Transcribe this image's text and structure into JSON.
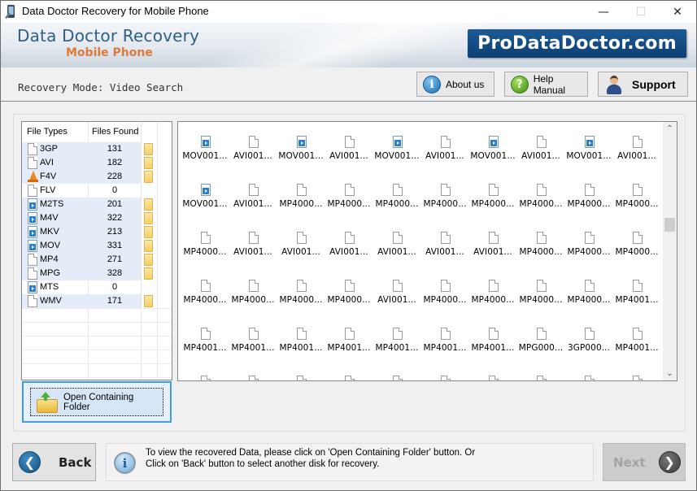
{
  "window": {
    "title": "Data Doctor Recovery for Mobile Phone",
    "controls": {
      "minimize": "—",
      "maximize": "☐",
      "close": "✕"
    }
  },
  "banner": {
    "brand_main": "Data Doctor Recovery",
    "brand_sub": "Mobile Phone",
    "logo_text": "ProDataDoctor.com"
  },
  "toolbar": {
    "mode_label": "Recovery Mode: Video Search",
    "about_label": "About us",
    "help_label": "Help Manual",
    "support_label": "Support",
    "about_icon": "i",
    "help_icon": "?"
  },
  "file_types": {
    "header_type": "File Types",
    "header_found": "Files Found",
    "rows": [
      {
        "type": "3GP",
        "count": "131",
        "icon": "document-icon",
        "has_folder": true
      },
      {
        "type": "AVI",
        "count": "182",
        "icon": "document-icon",
        "has_folder": true
      },
      {
        "type": "F4V",
        "count": "228",
        "icon": "vlc-cone-icon",
        "has_folder": true
      },
      {
        "type": "FLV",
        "count": "0",
        "icon": "document-icon",
        "has_folder": false
      },
      {
        "type": "M2TS",
        "count": "201",
        "icon": "video-file-icon",
        "has_folder": true
      },
      {
        "type": "M4V",
        "count": "322",
        "icon": "video-file-icon",
        "has_folder": true
      },
      {
        "type": "MKV",
        "count": "213",
        "icon": "video-file-icon",
        "has_folder": true
      },
      {
        "type": "MOV",
        "count": "331",
        "icon": "video-file-icon",
        "has_folder": true
      },
      {
        "type": "MP4",
        "count": "271",
        "icon": "document-icon",
        "has_folder": true
      },
      {
        "type": "MPG",
        "count": "328",
        "icon": "document-icon",
        "has_folder": true
      },
      {
        "type": "MTS",
        "count": "0",
        "icon": "video-file-icon",
        "has_folder": false
      },
      {
        "type": "WMV",
        "count": "171",
        "icon": "document-icon",
        "has_folder": true
      }
    ]
  },
  "open_folder": {
    "label": "Open Containing Folder"
  },
  "files": {
    "rows": [
      [
        {
          "name": "MOV001...",
          "icon": "video"
        },
        {
          "name": "AVI001...",
          "icon": "doc"
        },
        {
          "name": "MOV001...",
          "icon": "video"
        },
        {
          "name": "AVI001...",
          "icon": "doc"
        },
        {
          "name": "MOV001...",
          "icon": "video"
        },
        {
          "name": "AVI001...",
          "icon": "doc"
        },
        {
          "name": "MOV001...",
          "icon": "video"
        },
        {
          "name": "AVI001...",
          "icon": "doc"
        },
        {
          "name": "MOV001...",
          "icon": "video"
        },
        {
          "name": "AVI001...",
          "icon": "doc"
        }
      ],
      [
        {
          "name": "MOV001...",
          "icon": "video"
        },
        {
          "name": "AVI001...",
          "icon": "doc"
        },
        {
          "name": "MP4000...",
          "icon": "doc"
        },
        {
          "name": "MP4000...",
          "icon": "doc"
        },
        {
          "name": "MP4000...",
          "icon": "doc"
        },
        {
          "name": "MP4000...",
          "icon": "doc"
        },
        {
          "name": "MP4000...",
          "icon": "doc"
        },
        {
          "name": "MP4000...",
          "icon": "doc"
        },
        {
          "name": "MP4000...",
          "icon": "doc"
        },
        {
          "name": "MP4000...",
          "icon": "doc"
        }
      ],
      [
        {
          "name": "MP4000...",
          "icon": "doc"
        },
        {
          "name": "AVI001...",
          "icon": "doc"
        },
        {
          "name": "AVI001...",
          "icon": "doc"
        },
        {
          "name": "AVI001...",
          "icon": "doc"
        },
        {
          "name": "AVI001...",
          "icon": "doc"
        },
        {
          "name": "AVI001...",
          "icon": "doc"
        },
        {
          "name": "AVI001...",
          "icon": "doc"
        },
        {
          "name": "MP4000...",
          "icon": "doc"
        },
        {
          "name": "MP4000...",
          "icon": "doc"
        },
        {
          "name": "MP4000...",
          "icon": "doc"
        }
      ],
      [
        {
          "name": "MP4000...",
          "icon": "doc"
        },
        {
          "name": "MP4000...",
          "icon": "doc"
        },
        {
          "name": "MP4000...",
          "icon": "doc"
        },
        {
          "name": "MP4000...",
          "icon": "doc"
        },
        {
          "name": "AVI001...",
          "icon": "doc"
        },
        {
          "name": "MP4000...",
          "icon": "doc"
        },
        {
          "name": "MP4000...",
          "icon": "doc"
        },
        {
          "name": "MP4000...",
          "icon": "doc"
        },
        {
          "name": "MP4000...",
          "icon": "doc"
        },
        {
          "name": "MP4001...",
          "icon": "doc"
        }
      ],
      [
        {
          "name": "MP4001...",
          "icon": "doc"
        },
        {
          "name": "MP4001...",
          "icon": "doc"
        },
        {
          "name": "MP4001...",
          "icon": "doc"
        },
        {
          "name": "MP4001...",
          "icon": "doc"
        },
        {
          "name": "MP4001...",
          "icon": "doc"
        },
        {
          "name": "MP4001...",
          "icon": "doc"
        },
        {
          "name": "MP4001...",
          "icon": "doc"
        },
        {
          "name": "MPG000...",
          "icon": "doc"
        },
        {
          "name": "3GP000...",
          "icon": "doc"
        },
        {
          "name": "MP4001...",
          "icon": "doc"
        }
      ],
      [
        {
          "name": "",
          "icon": "doc"
        },
        {
          "name": "",
          "icon": "doc"
        },
        {
          "name": "",
          "icon": "doc"
        },
        {
          "name": "",
          "icon": "doc"
        },
        {
          "name": "",
          "icon": "doc"
        },
        {
          "name": "",
          "icon": "doc"
        },
        {
          "name": "",
          "icon": "doc"
        },
        {
          "name": "",
          "icon": "doc"
        },
        {
          "name": "",
          "icon": "doc"
        },
        {
          "name": "",
          "icon": "doc"
        }
      ]
    ],
    "scroll_position": 0.38
  },
  "bottom": {
    "back_label": "Back",
    "next_label": "Next",
    "next_enabled": false,
    "info_line1": "To view the recovered Data, please click on 'Open Containing Folder' button. Or",
    "info_line2": "Click on 'Back' button to select another disk for recovery."
  },
  "colors": {
    "brand_blue": "#2f5f88",
    "brand_orange": "#e07a3c",
    "logo_bg": "#0b3f74",
    "selection_bg": "#e3ecf7",
    "focus_border": "#3c9ee6"
  }
}
